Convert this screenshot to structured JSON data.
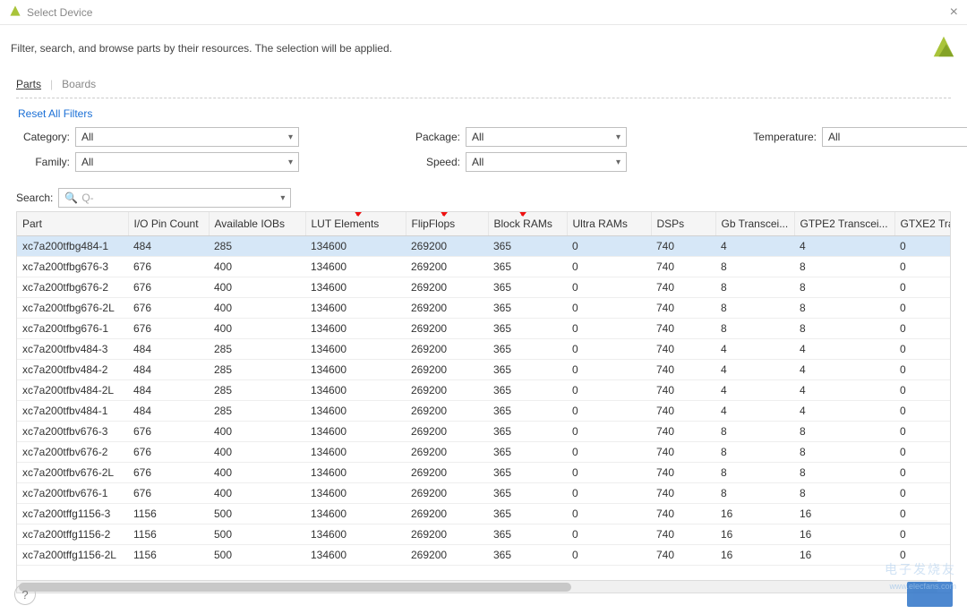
{
  "window": {
    "title": "Select Device",
    "close": "×"
  },
  "subtitle": "Filter, search, and browse parts by their resources. The selection will be applied.",
  "tabs": {
    "parts": "Parts",
    "boards": "Boards",
    "sep": "|"
  },
  "reset_link": "Reset All Filters",
  "filters": {
    "category": {
      "label": "Category:",
      "value": "All"
    },
    "family": {
      "label": "Family:",
      "value": "All"
    },
    "package": {
      "label": "Package:",
      "value": "All"
    },
    "speed": {
      "label": "Speed:",
      "value": "All"
    },
    "temperature": {
      "label": "Temperature:",
      "value": "All"
    }
  },
  "search": {
    "label": "Search:",
    "placeholder": "Q-"
  },
  "columns": [
    "Part",
    "I/O Pin Count",
    "Available IOBs",
    "LUT Elements",
    "FlipFlops",
    "Block RAMs",
    "Ultra RAMs",
    "DSPs",
    "Gb Transcei...",
    "GTPE2 Transcei...",
    "GTXE2 Tra"
  ],
  "selected_index": 0,
  "rows": [
    {
      "part": "xc7a200tfbg484-1",
      "io": "484",
      "iob": "285",
      "lut": "134600",
      "ff": "269200",
      "bram": "365",
      "uram": "0",
      "dsp": "740",
      "gb": "4",
      "gtpe2": "4",
      "gtxe2": "0"
    },
    {
      "part": "xc7a200tfbg676-3",
      "io": "676",
      "iob": "400",
      "lut": "134600",
      "ff": "269200",
      "bram": "365",
      "uram": "0",
      "dsp": "740",
      "gb": "8",
      "gtpe2": "8",
      "gtxe2": "0"
    },
    {
      "part": "xc7a200tfbg676-2",
      "io": "676",
      "iob": "400",
      "lut": "134600",
      "ff": "269200",
      "bram": "365",
      "uram": "0",
      "dsp": "740",
      "gb": "8",
      "gtpe2": "8",
      "gtxe2": "0"
    },
    {
      "part": "xc7a200tfbg676-2L",
      "io": "676",
      "iob": "400",
      "lut": "134600",
      "ff": "269200",
      "bram": "365",
      "uram": "0",
      "dsp": "740",
      "gb": "8",
      "gtpe2": "8",
      "gtxe2": "0"
    },
    {
      "part": "xc7a200tfbg676-1",
      "io": "676",
      "iob": "400",
      "lut": "134600",
      "ff": "269200",
      "bram": "365",
      "uram": "0",
      "dsp": "740",
      "gb": "8",
      "gtpe2": "8",
      "gtxe2": "0"
    },
    {
      "part": "xc7a200tfbv484-3",
      "io": "484",
      "iob": "285",
      "lut": "134600",
      "ff": "269200",
      "bram": "365",
      "uram": "0",
      "dsp": "740",
      "gb": "4",
      "gtpe2": "4",
      "gtxe2": "0"
    },
    {
      "part": "xc7a200tfbv484-2",
      "io": "484",
      "iob": "285",
      "lut": "134600",
      "ff": "269200",
      "bram": "365",
      "uram": "0",
      "dsp": "740",
      "gb": "4",
      "gtpe2": "4",
      "gtxe2": "0"
    },
    {
      "part": "xc7a200tfbv484-2L",
      "io": "484",
      "iob": "285",
      "lut": "134600",
      "ff": "269200",
      "bram": "365",
      "uram": "0",
      "dsp": "740",
      "gb": "4",
      "gtpe2": "4",
      "gtxe2": "0"
    },
    {
      "part": "xc7a200tfbv484-1",
      "io": "484",
      "iob": "285",
      "lut": "134600",
      "ff": "269200",
      "bram": "365",
      "uram": "0",
      "dsp": "740",
      "gb": "4",
      "gtpe2": "4",
      "gtxe2": "0"
    },
    {
      "part": "xc7a200tfbv676-3",
      "io": "676",
      "iob": "400",
      "lut": "134600",
      "ff": "269200",
      "bram": "365",
      "uram": "0",
      "dsp": "740",
      "gb": "8",
      "gtpe2": "8",
      "gtxe2": "0"
    },
    {
      "part": "xc7a200tfbv676-2",
      "io": "676",
      "iob": "400",
      "lut": "134600",
      "ff": "269200",
      "bram": "365",
      "uram": "0",
      "dsp": "740",
      "gb": "8",
      "gtpe2": "8",
      "gtxe2": "0"
    },
    {
      "part": "xc7a200tfbv676-2L",
      "io": "676",
      "iob": "400",
      "lut": "134600",
      "ff": "269200",
      "bram": "365",
      "uram": "0",
      "dsp": "740",
      "gb": "8",
      "gtpe2": "8",
      "gtxe2": "0"
    },
    {
      "part": "xc7a200tfbv676-1",
      "io": "676",
      "iob": "400",
      "lut": "134600",
      "ff": "269200",
      "bram": "365",
      "uram": "0",
      "dsp": "740",
      "gb": "8",
      "gtpe2": "8",
      "gtxe2": "0"
    },
    {
      "part": "xc7a200tffg1156-3",
      "io": "1156",
      "iob": "500",
      "lut": "134600",
      "ff": "269200",
      "bram": "365",
      "uram": "0",
      "dsp": "740",
      "gb": "16",
      "gtpe2": "16",
      "gtxe2": "0"
    },
    {
      "part": "xc7a200tffg1156-2",
      "io": "1156",
      "iob": "500",
      "lut": "134600",
      "ff": "269200",
      "bram": "365",
      "uram": "0",
      "dsp": "740",
      "gb": "16",
      "gtpe2": "16",
      "gtxe2": "0"
    },
    {
      "part": "xc7a200tffg1156-2L",
      "io": "1156",
      "iob": "500",
      "lut": "134600",
      "ff": "269200",
      "bram": "365",
      "uram": "0",
      "dsp": "740",
      "gb": "16",
      "gtpe2": "16",
      "gtxe2": "0"
    }
  ],
  "watermark": {
    "big": "电子发烧友",
    "small": "www.elecfans.com"
  }
}
